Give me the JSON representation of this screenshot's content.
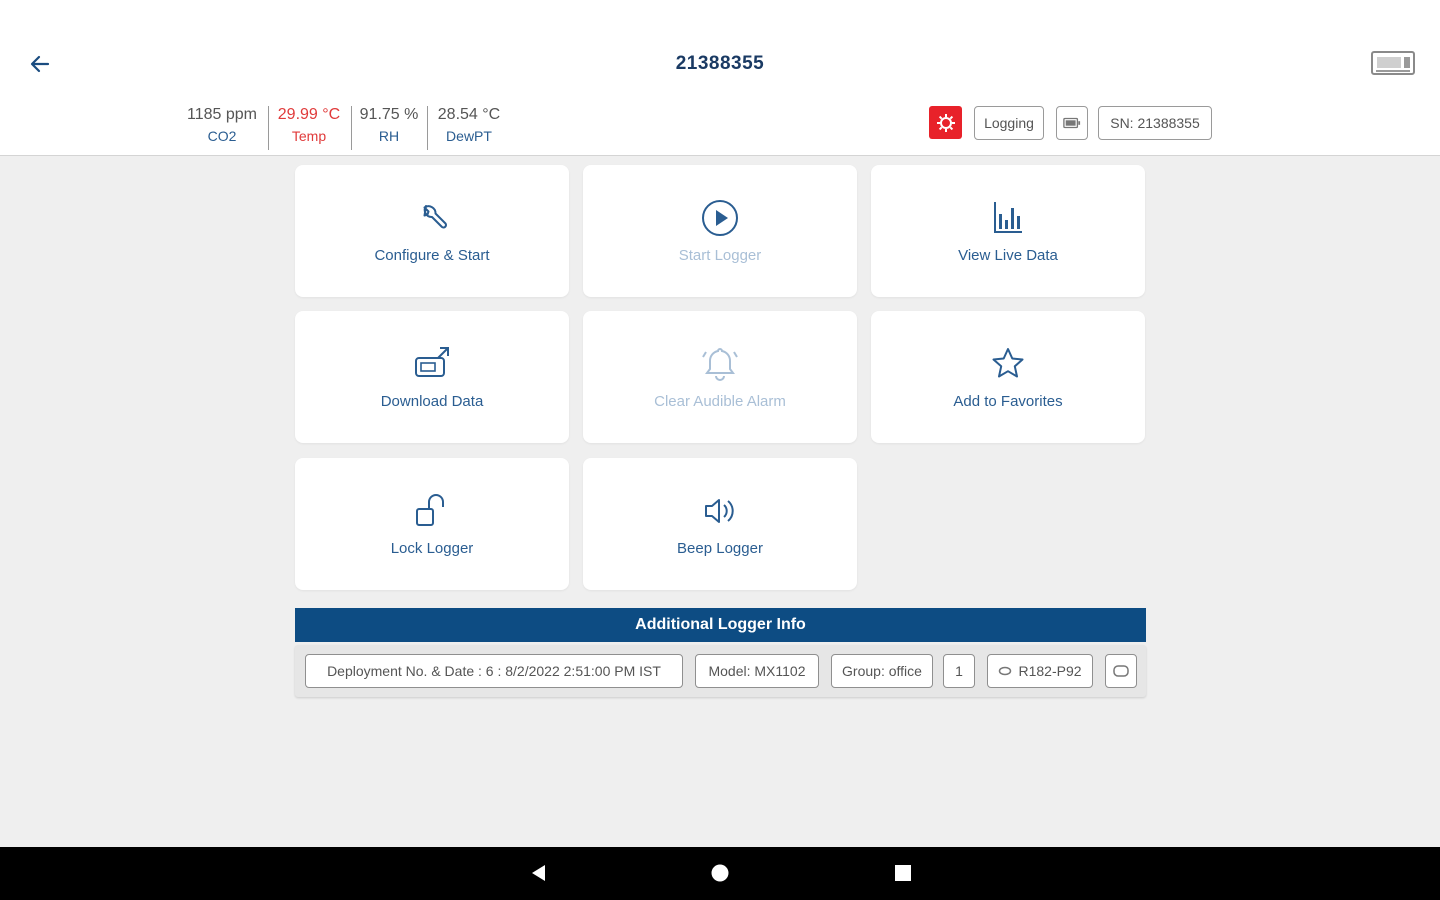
{
  "header": {
    "title": "21388355",
    "back_icon": "arrow-left-icon",
    "device_icon": "logger-device-icon"
  },
  "readings": [
    {
      "value": "1185 ppm",
      "label": "CO2",
      "alarm": false
    },
    {
      "value": "29.99 °C",
      "label": "Temp",
      "alarm": true
    },
    {
      "value": "91.75 %",
      "label": "RH",
      "alarm": false
    },
    {
      "value": "28.54 °C",
      "label": "DewPT",
      "alarm": false
    }
  ],
  "status": {
    "alarm_icon": "alarm-indicator-icon",
    "alarm_color": "#e8222a",
    "logging_label": "Logging",
    "battery_icon": "battery-icon",
    "serial_label": "SN: 21388355"
  },
  "actions": [
    {
      "label": "Configure & Start",
      "icon": "wrench-icon",
      "enabled": true
    },
    {
      "label": "Start Logger",
      "icon": "play-icon",
      "enabled": false
    },
    {
      "label": "View Live Data",
      "icon": "bar-chart-icon",
      "enabled": true
    },
    {
      "label": "Download Data",
      "icon": "download-device-icon",
      "enabled": true
    },
    {
      "label": "Clear Audible Alarm",
      "icon": "bell-icon",
      "enabled": false
    },
    {
      "label": "Add to Favorites",
      "icon": "star-icon",
      "enabled": true
    },
    {
      "label": "Lock Logger",
      "icon": "unlock-icon",
      "enabled": true
    },
    {
      "label": "Beep Logger",
      "icon": "speaker-icon",
      "enabled": true
    }
  ],
  "info": {
    "header": "Additional Logger Info",
    "deployment": "Deployment No. & Date : 6 : 8/2/2022 2:51:00 PM IST",
    "model": "Model: MX1102",
    "group": "Group: office",
    "extra": "1",
    "firmware": "R182-P92"
  },
  "colors": {
    "accent": "#0d4c83",
    "text_primary": "#2a5d91",
    "text_disabled": "#a9bfd6",
    "alarm": "#e03a3a"
  },
  "nav": {
    "back_icon": "nav-back-triangle-icon",
    "home_icon": "nav-home-circle-icon",
    "recents_icon": "nav-recents-square-icon"
  }
}
